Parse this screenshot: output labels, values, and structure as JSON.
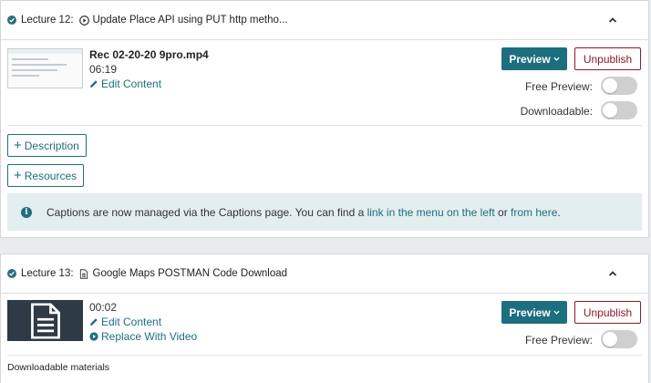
{
  "lecture12": {
    "label": "Lecture 12:",
    "title": "Update Place API using PUT http metho...",
    "file_name": "Rec 02-20-20 9pro.mp4",
    "duration": "06:19",
    "edit_content": "Edit Content",
    "preview_label": "Preview",
    "unpublish_label": "Unpublish",
    "free_preview_label": "Free Preview:",
    "free_preview_on": false,
    "downloadable_label": "Downloadable:",
    "downloadable_on": false,
    "description_label": "Description",
    "resources_label": "Resources",
    "info": {
      "text_before": "Captions are now managed via the Captions page. You can find a ",
      "link1": "link in the menu on the left",
      "text_middle": " or ",
      "link2": "from here",
      "text_after": "."
    }
  },
  "lecture13": {
    "label": "Lecture 13:",
    "title": "Google Maps POSTMAN Code Download",
    "duration": "00:02",
    "edit_content": "Edit Content",
    "replace_video": "Replace With Video",
    "preview_label": "Preview",
    "unpublish_label": "Unpublish",
    "free_preview_label": "Free Preview:",
    "free_preview_on": false,
    "downloadable_materials": "Downloadable materials"
  },
  "colors": {
    "accent": "#1d6e7f",
    "danger": "#8a1a2b",
    "info_bg": "#e3eef1",
    "page_bg": "#e9ecef"
  }
}
